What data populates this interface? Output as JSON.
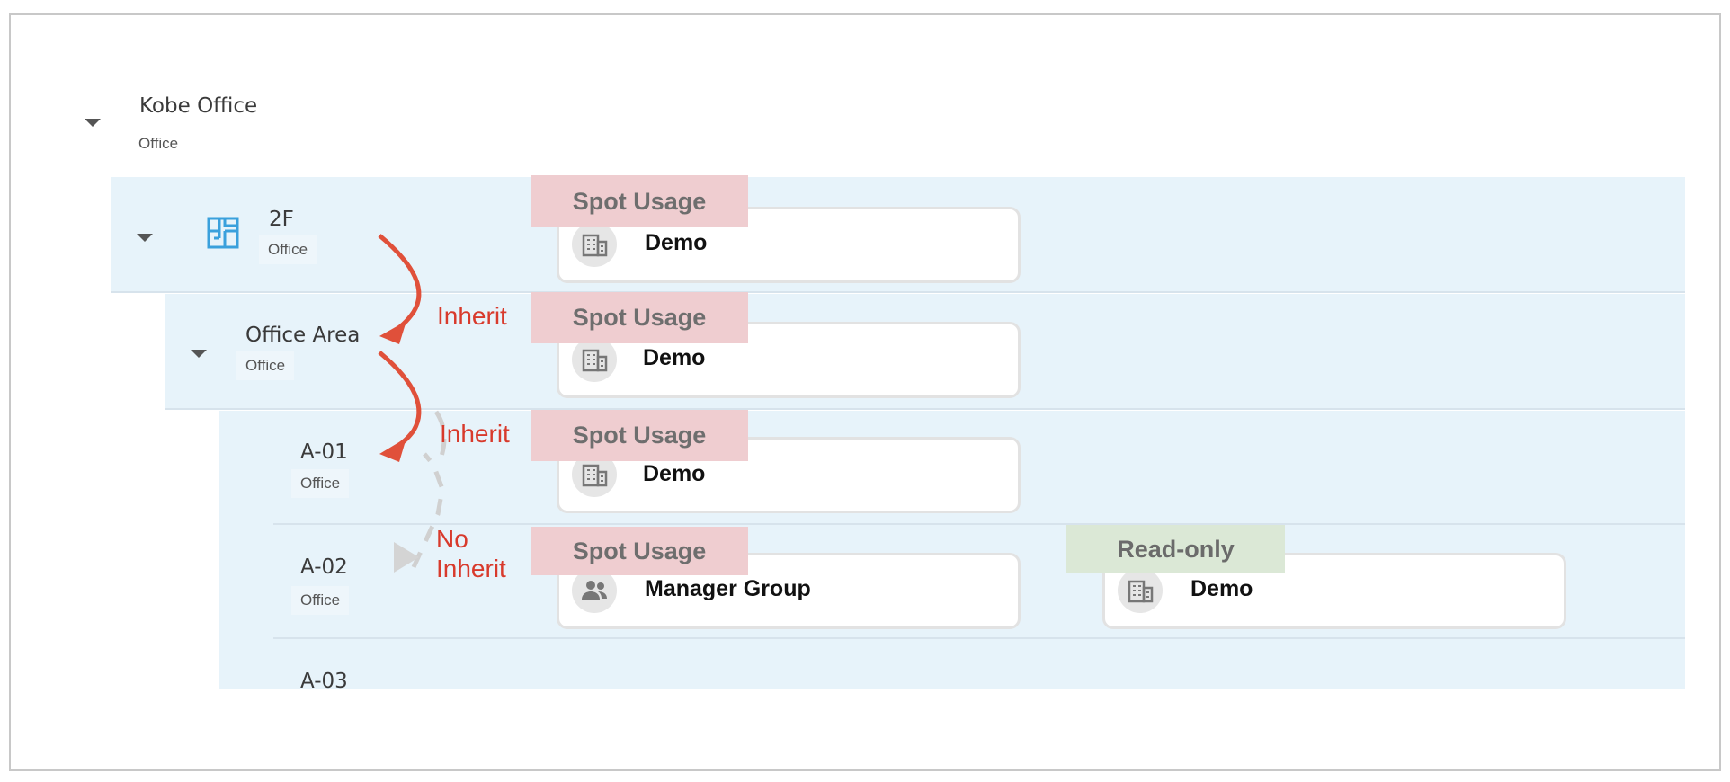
{
  "tree": {
    "root": {
      "title": "Kobe Office",
      "subtitle": "Office"
    },
    "nodes": [
      {
        "title": "2F",
        "subtitle": "Office"
      },
      {
        "title": "Office Area",
        "subtitle": "Office"
      },
      {
        "title": "A-01",
        "subtitle": "Office"
      },
      {
        "title": "A-02",
        "subtitle": "Office"
      },
      {
        "title": "A-03"
      }
    ]
  },
  "permissions": {
    "spot_usage_label": "Spot Usage",
    "read_only_label": "Read-only",
    "rows": [
      {
        "spot_usage": "Demo"
      },
      {
        "spot_usage": "Demo"
      },
      {
        "spot_usage": "Demo"
      },
      {
        "spot_usage": "Manager Group",
        "read_only": "Demo"
      }
    ]
  },
  "annotations": {
    "inherit_1": "Inherit",
    "inherit_2": "Inherit",
    "no_inherit_line1": "No",
    "no_inherit_line2": "Inherit",
    "arrow_color": "#e0503a"
  },
  "icons": {
    "expand": "caret-down-icon",
    "floor": "floor-plan-icon",
    "organization": "building-icon",
    "group": "people-icon",
    "collapsed": "caret-right-icon"
  }
}
